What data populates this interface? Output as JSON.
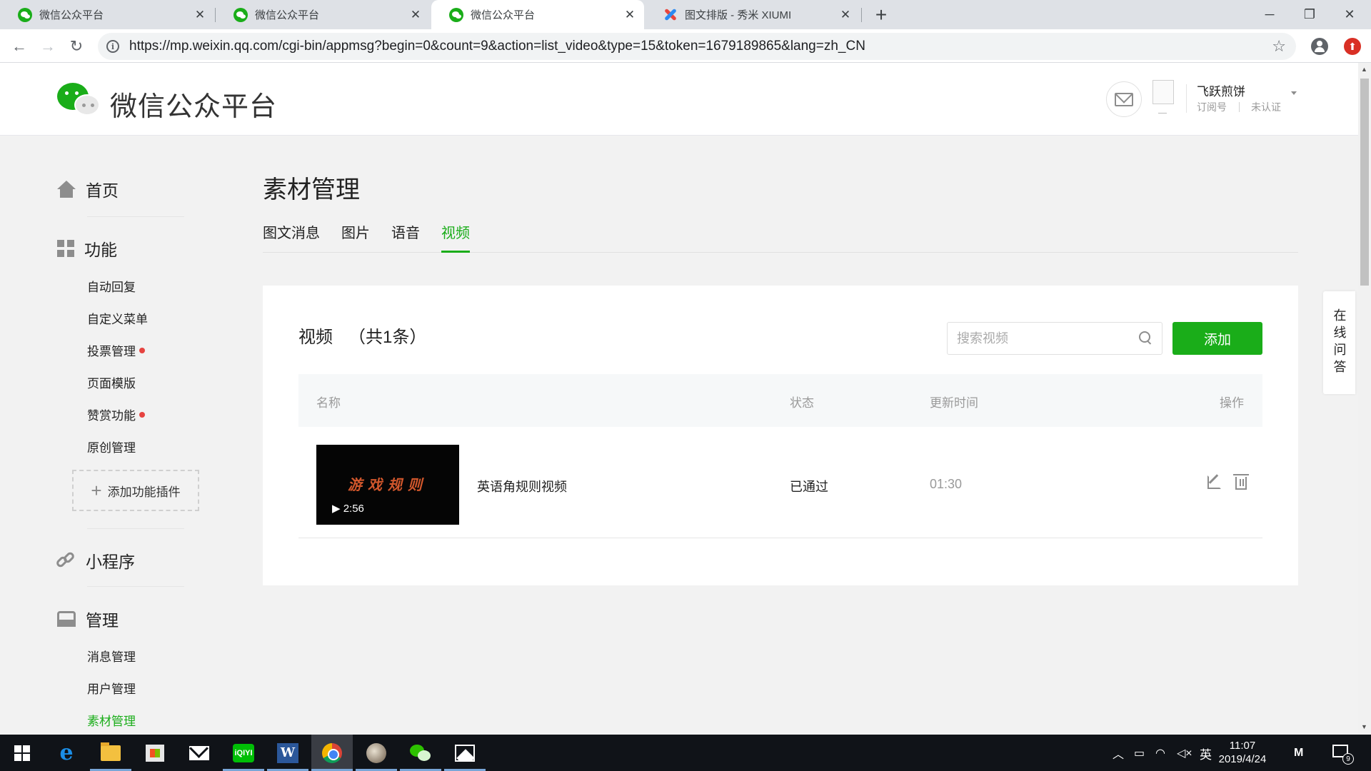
{
  "browser": {
    "tabs": [
      {
        "title": "微信公众平台",
        "favicon": "wechat-icon",
        "active": false
      },
      {
        "title": "微信公众平台",
        "favicon": "wechat-icon",
        "active": false
      },
      {
        "title": "微信公众平台",
        "favicon": "wechat-icon",
        "active": true
      },
      {
        "title": "图文排版 - 秀米 XIUMI",
        "favicon": "xiumi-icon",
        "active": false
      }
    ],
    "url": "https://mp.weixin.qq.com/cgi-bin/appmsg?begin=0&count=9&action=list_video&type=15&token=1679189865&lang=zh_CN",
    "glyphs": {
      "close": "✕",
      "new_tab": "+",
      "minimize": "─",
      "maximize": "❐",
      "window_close": "✕",
      "back": "←",
      "forward": "→",
      "reload": "↻",
      "info": "i",
      "star": "☆",
      "up": "▲",
      "down": "▼"
    }
  },
  "header": {
    "logo_text": "微信公众平台",
    "account_name": "飞跃煎饼",
    "account_type": "订阅号",
    "verification": "未认证"
  },
  "sidebar": {
    "home": "首页",
    "features": "功能",
    "feature_items": [
      {
        "label": "自动回复",
        "badge": false
      },
      {
        "label": "自定义菜单",
        "badge": false
      },
      {
        "label": "投票管理",
        "badge": true
      },
      {
        "label": "页面模版",
        "badge": false
      },
      {
        "label": "赞赏功能",
        "badge": true
      },
      {
        "label": "原创管理",
        "badge": false
      }
    ],
    "add_plugin": "添加功能插件",
    "mini_program": "小程序",
    "manage": "管理",
    "manage_items": [
      {
        "label": "消息管理",
        "active": false
      },
      {
        "label": "用户管理",
        "active": false
      },
      {
        "label": "素材管理",
        "active": true
      }
    ]
  },
  "main": {
    "title": "素材管理",
    "tabs": [
      {
        "label": "图文消息",
        "active": false
      },
      {
        "label": "图片",
        "active": false
      },
      {
        "label": "语音",
        "active": false
      },
      {
        "label": "视频",
        "active": true
      }
    ],
    "section_title": "视频",
    "section_count": "（共1条）",
    "search_placeholder": "搜索视频",
    "add_button": "添加",
    "columns": {
      "name": "名称",
      "status": "状态",
      "updated": "更新时间",
      "actions": "操作"
    },
    "rows": [
      {
        "thumbnail_text": "游戏规则",
        "duration": "▶ 2:56",
        "name": "英语角规则视频",
        "status": "已通过",
        "updated": "01:30"
      }
    ]
  },
  "qa_tab": "在线问答",
  "taskbar": {
    "apps": [
      "start-icon",
      "edge-icon",
      "file-explorer-icon",
      "store-icon",
      "mail-icon",
      "iqiyi-icon",
      "word-icon",
      "chrome-icon",
      "photo-app-icon",
      "wechat-icon",
      "photos-icon"
    ],
    "iqiyi_label": "iQIYI",
    "word_label": "W",
    "ie_label": "e",
    "ime": "英",
    "time": "11:07",
    "date": "2019/4/24",
    "notification_count": "9"
  },
  "colors": {
    "accent": "#1aad19",
    "badge": "#e64340",
    "thumbnail_text": "#d2572c"
  }
}
